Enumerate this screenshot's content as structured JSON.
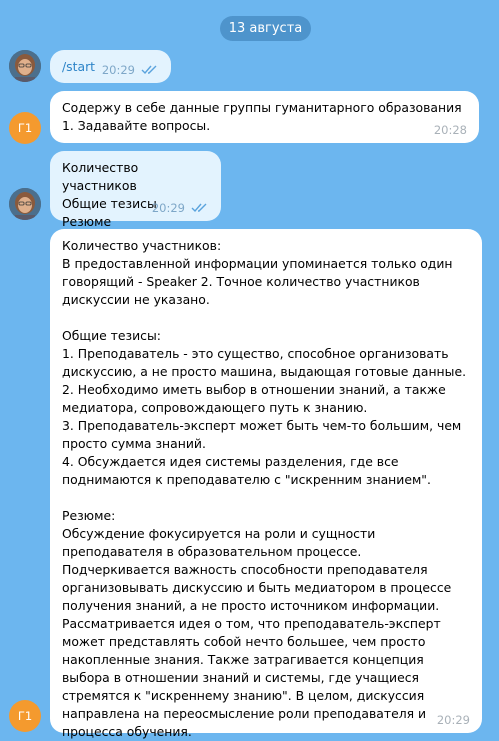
{
  "date_separator": "13 августа",
  "colors": {
    "background": "#6cb6ef",
    "outgoing_bubble": "#e3f3fe",
    "incoming_bubble": "#ffffff",
    "bot_avatar": "#f49a2e",
    "link": "#2d84c8"
  },
  "bot_avatar_initials": "Г1",
  "messages": [
    {
      "direction": "outgoing",
      "text": "/start",
      "time": "20:29",
      "status": "read-double-check-icon"
    },
    {
      "direction": "incoming",
      "text": "Содержу в себе данные группы гуманитарного образования 1. Задавайте вопросы.",
      "time": "20:28"
    },
    {
      "direction": "outgoing",
      "text": "Количество участников\nОбщие тезисы\nРезюме",
      "time": "20:29",
      "status": "read-double-check-icon"
    },
    {
      "direction": "incoming",
      "text": "Количество участников:\nВ предоставленной информации упоминается только один говорящий - Speaker 2. Точное количество участников дискуссии не указано.\n\nОбщие тезисы:\n1. Преподаватель - это существо, способное организовать дискуссию, а не просто машина, выдающая готовые данные.\n2. Необходимо иметь выбор в отношении знаний, а также медиатора, сопровождающего путь к знанию.\n3. Преподаватель-эксперт может быть чем-то большим, чем просто сумма знаний.\n4. Обсуждается идея системы разделения, где все поднимаются к преподавателю с \"искренним знанием\".\n\nРезюме:\nОбсуждение фокусируется на роли и сущности преподавателя в образовательном процессе. Подчеркивается важность способности преподавателя организовывать дискуссию и быть медиатором в процессе получения знаний, а не просто источником информации. Рассматривается идея о том, что преподаватель-эксперт может представлять собой нечто большее, чем просто накопленные знания. Также затрагивается концепция выбора в отношении знаний и системы, где учащиеся стремятся к \"искреннему знанию\". В целом, дискуссия направлена на переосмысление роли преподавателя и процесса обучения.",
      "time": "20:29"
    }
  ]
}
